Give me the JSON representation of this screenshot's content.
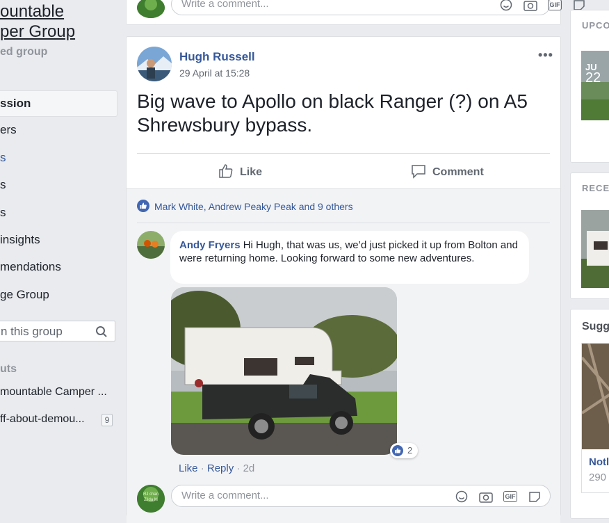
{
  "sidebar": {
    "group_name_line1": "ountable",
    "group_name_line2": "per Group",
    "group_type": "ed group",
    "nav": [
      {
        "label": "ssion"
      },
      {
        "label": "ers"
      },
      {
        "label": "s"
      },
      {
        "label": "s"
      },
      {
        "label": "s"
      },
      {
        "label": " insights"
      },
      {
        "label": "mendations"
      },
      {
        "label": "ge Group"
      }
    ],
    "search_placeholder": "n this group",
    "shortcuts_heading": "uts",
    "shortcuts": [
      {
        "label": "mountable Camper ..."
      },
      {
        "label": "ff-about-demou...",
        "count": "9"
      }
    ]
  },
  "top_comment_bar": {
    "placeholder": "Write a comment..."
  },
  "post": {
    "author": "Hugh Russell",
    "timestamp": "29 April at 15:28",
    "text": "Big wave to Apollo on black Ranger (?) on A5 Shrewsbury bypass.",
    "like_label": "Like",
    "comment_label": "Comment",
    "reactions_text": "Mark White, Andrew Peaky Peak and 9 others",
    "comment": {
      "author": "Andy Fryers",
      "text": " Hi Hugh, that was us, we’d just picked it up from Bolton and were returning home. Looking forward to some new adventures.",
      "like_count": "2",
      "like": "Like",
      "reply": "Reply",
      "age": "2d",
      "sep": "·"
    },
    "write_comment_placeholder": "Write a comment...",
    "avatar_text": "RJ chan Zilda M"
  },
  "right": {
    "upcoming_heading": "UPCO",
    "event_month": "JU",
    "event_day": "22",
    "recent_heading": "RECEI",
    "suggested_heading": "Sugg",
    "suggested_name": "Notl",
    "suggested_count": "290"
  },
  "colors": {
    "link": "#365899",
    "background": "#e9ebee",
    "like_blue": "#4267b2"
  }
}
